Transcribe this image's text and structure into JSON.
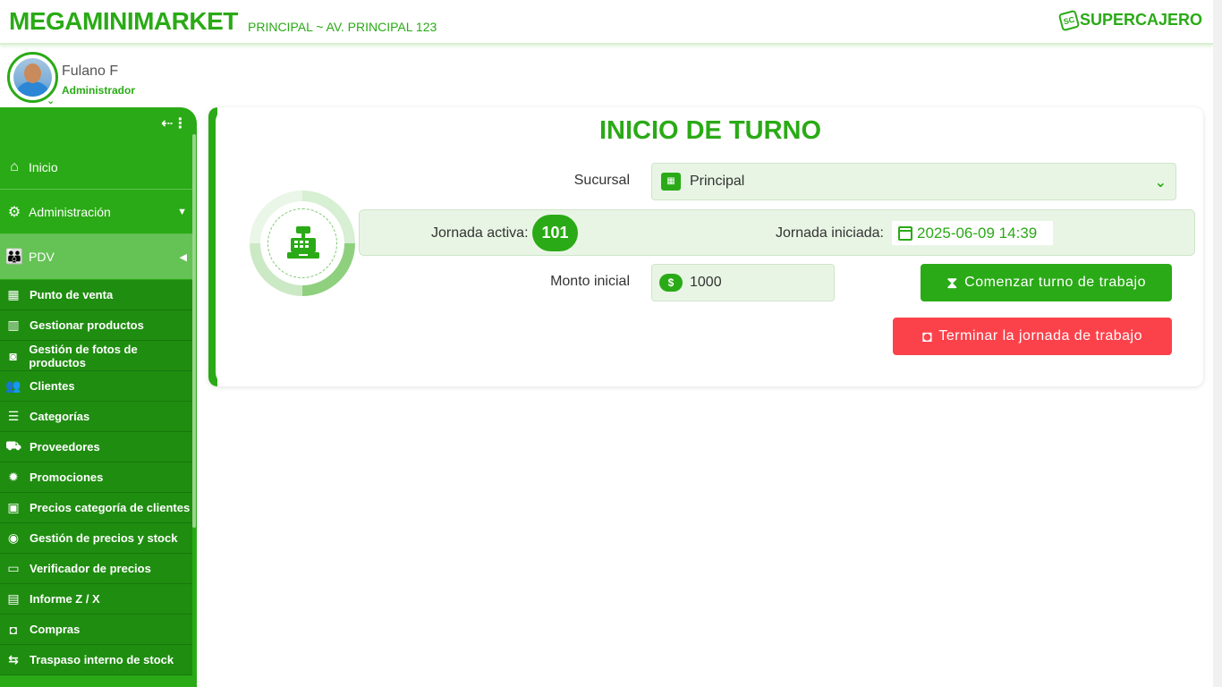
{
  "header": {
    "brand": "MEGAMINIMARKET",
    "branch": "PRINCIPAL ~ AV. PRINCIPAL 123",
    "logo_text": "SUPERCAJERO",
    "logo_badge": "SC"
  },
  "user": {
    "name": "Fulano F",
    "role": "Administrador"
  },
  "sidebar": {
    "top_items": [
      {
        "label": "Inicio",
        "icon": "home-icon",
        "glyph": "⌂"
      },
      {
        "label": "Administración",
        "icon": "gear-icon",
        "glyph": "⚙",
        "caret": "▼"
      },
      {
        "label": "PDV",
        "icon": "people-icon",
        "glyph": "👪",
        "caret": "◀"
      }
    ],
    "sub_items": [
      {
        "label": "Punto de venta",
        "icon": "cash-register-icon",
        "glyph": "▦"
      },
      {
        "label": "Gestionar productos",
        "icon": "barcode-icon",
        "glyph": "▥"
      },
      {
        "label": "Gestión de fotos de productos",
        "icon": "camera-icon",
        "glyph": "◙"
      },
      {
        "label": "Clientes",
        "icon": "users-icon",
        "glyph": "👥"
      },
      {
        "label": "Categorías",
        "icon": "list-icon",
        "glyph": "☰"
      },
      {
        "label": "Proveedores",
        "icon": "truck-icon",
        "glyph": "⛟"
      },
      {
        "label": "Promociones",
        "icon": "badge-icon",
        "glyph": "✹"
      },
      {
        "label": "Precios categoría de clientes",
        "icon": "id-card-icon",
        "glyph": "▣"
      },
      {
        "label": "Gestión de precios y stock",
        "icon": "coins-icon",
        "glyph": "◉"
      },
      {
        "label": "Verificador de precios",
        "icon": "monitor-icon",
        "glyph": "▭"
      },
      {
        "label": "Informe Z / X",
        "icon": "newspaper-icon",
        "glyph": "▤"
      },
      {
        "label": "Compras",
        "icon": "shopping-bag-icon",
        "glyph": "◘"
      },
      {
        "label": "Traspaso interno de stock",
        "icon": "exchange-icon",
        "glyph": "⇆"
      }
    ]
  },
  "main": {
    "title": "INICIO DE TURNO",
    "sucursal_label": "Sucursal",
    "sucursal_value": "Principal",
    "jornada_activa_label": "Jornada activa:",
    "jornada_activa_value": "101",
    "jornada_iniciada_label": "Jornada iniciada:",
    "jornada_iniciada_value": "2025-06-09 14:39",
    "monto_label": "Monto inicial",
    "monto_value": "1000",
    "start_button": "Comenzar turno de trabajo",
    "end_button": "Terminar la jornada de trabajo"
  },
  "colors": {
    "brand_green": "#2aaa16",
    "danger_red": "#fb424b",
    "light_green": "#e8f5e4"
  }
}
